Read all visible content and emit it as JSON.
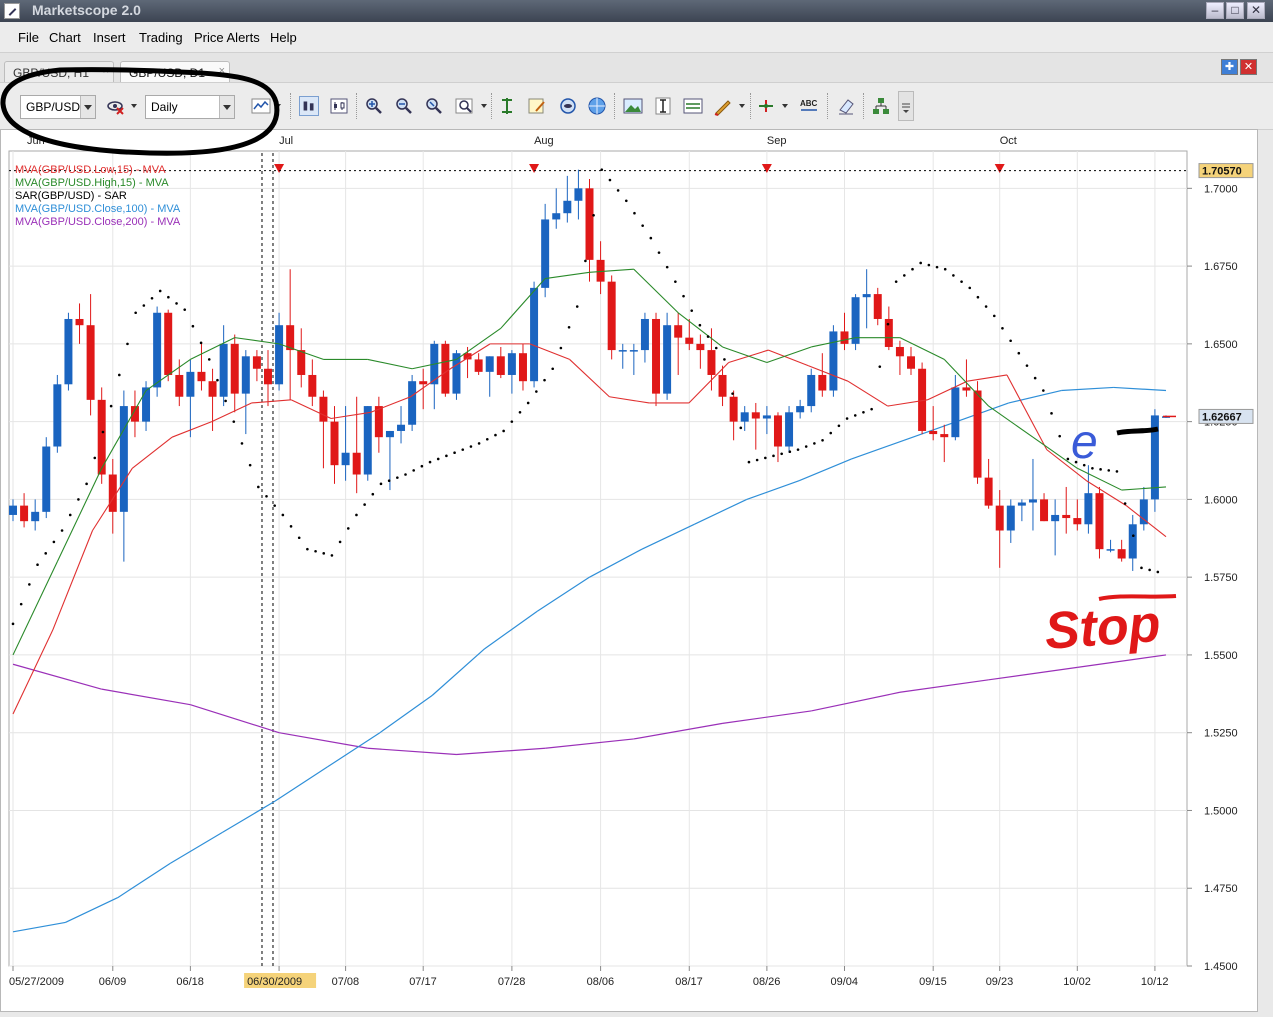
{
  "window": {
    "title": "Marketscope 2.0"
  },
  "menu": [
    "File",
    "Chart",
    "Insert",
    "Trading",
    "Price Alerts",
    "Help"
  ],
  "tabs": [
    {
      "label": "GBP/USD, H1",
      "active": false
    },
    {
      "label": "GBP/USD, D1",
      "active": true
    }
  ],
  "toolbar": {
    "instrument": "GBP/USD",
    "period": "Daily",
    "icons": [
      "cancel-eye-icon",
      "line-chart-icon",
      "bar-style-icon",
      "candle-style-icon",
      "zoom-in-icon",
      "zoom-out-icon",
      "zoom-fit-icon",
      "zoom-range-icon",
      "vertical-bar-icon",
      "note-icon",
      "globe-eye-icon",
      "globe-icon",
      "image-icon",
      "cursor-line-icon",
      "panel-icon",
      "pencil-icon",
      "trend-icon",
      "text-abc-icon",
      "eraser-icon",
      "tree-icon",
      "more-icon"
    ]
  },
  "chart_data": {
    "type": "candlestick",
    "instrument": "GBP/USD",
    "timeframe": "D1",
    "month_labels": [
      "Jun",
      "Jul",
      "Aug",
      "Sep",
      "Oct"
    ],
    "x_tick_labels": [
      "05/27/2009",
      "06/09",
      "06/18",
      "06/30/2009",
      "07/08",
      "07/17",
      "07/28",
      "08/06",
      "08/17",
      "08/26",
      "09/04",
      "09/15",
      "09/23",
      "10/02",
      "10/12"
    ],
    "highlighted_x_label": "06/30/2009",
    "y_tick_labels": [
      "1.7000",
      "1.6750",
      "1.6500",
      "1.6250",
      "1.6000",
      "1.5750",
      "1.5500",
      "1.5250",
      "1.5000",
      "1.4750",
      "1.4500"
    ],
    "ylim": [
      1.45,
      1.712
    ],
    "price_markers": [
      {
        "label": "1.70570",
        "value": 1.7057,
        "color": "#f5d37a"
      },
      {
        "label": "1.62667",
        "value": 1.62667,
        "color": "#d8e3f0"
      }
    ],
    "legend": [
      {
        "label": "MVA(GBP/USD.Low,15) - MVA",
        "color": "#e03030"
      },
      {
        "label": "MVA(GBP/USD.High,15) - MVA",
        "color": "#2a8a2a"
      },
      {
        "label": "SAR(GBP/USD) - SAR",
        "color": "#000000"
      },
      {
        "label": "MVA(GBP/USD.Close,100) - MVA",
        "color": "#2f8fd8"
      },
      {
        "label": "MVA(GBP/USD.Close,200) - MVA",
        "color": "#9a30b8"
      }
    ],
    "up_color": "#1a64c0",
    "down_color": "#e01818",
    "candles": [
      [
        1.595,
        1.6,
        1.593,
        1.598
      ],
      [
        1.598,
        1.602,
        1.591,
        1.593
      ],
      [
        1.593,
        1.6,
        1.59,
        1.596
      ],
      [
        1.596,
        1.62,
        1.594,
        1.617
      ],
      [
        1.617,
        1.64,
        1.615,
        1.637
      ],
      [
        1.637,
        1.66,
        1.635,
        1.658
      ],
      [
        1.658,
        1.663,
        1.65,
        1.656
      ],
      [
        1.656,
        1.666,
        1.627,
        1.632
      ],
      [
        1.632,
        1.636,
        1.605,
        1.608
      ],
      [
        1.608,
        1.613,
        1.589,
        1.596
      ],
      [
        1.596,
        1.635,
        1.58,
        1.63
      ],
      [
        1.63,
        1.635,
        1.62,
        1.625
      ],
      [
        1.625,
        1.638,
        1.622,
        1.636
      ],
      [
        1.636,
        1.662,
        1.633,
        1.66
      ],
      [
        1.66,
        1.661,
        1.638,
        1.64
      ],
      [
        1.64,
        1.645,
        1.63,
        1.633
      ],
      [
        1.633,
        1.645,
        1.62,
        1.641
      ],
      [
        1.641,
        1.65,
        1.635,
        1.638
      ],
      [
        1.638,
        1.642,
        1.622,
        1.633
      ],
      [
        1.633,
        1.656,
        1.63,
        1.65
      ],
      [
        1.65,
        1.653,
        1.628,
        1.634
      ],
      [
        1.634,
        1.648,
        1.621,
        1.646
      ],
      [
        1.646,
        1.648,
        1.638,
        1.642
      ],
      [
        1.642,
        1.648,
        1.63,
        1.637
      ],
      [
        1.637,
        1.66,
        1.635,
        1.656
      ],
      [
        1.656,
        1.674,
        1.632,
        1.648
      ],
      [
        1.648,
        1.655,
        1.636,
        1.64
      ],
      [
        1.64,
        1.645,
        1.63,
        1.633
      ],
      [
        1.633,
        1.635,
        1.61,
        1.625
      ],
      [
        1.625,
        1.63,
        1.605,
        1.611
      ],
      [
        1.611,
        1.63,
        1.606,
        1.615
      ],
      [
        1.615,
        1.633,
        1.602,
        1.608
      ],
      [
        1.608,
        1.63,
        1.606,
        1.63
      ],
      [
        1.63,
        1.633,
        1.615,
        1.62
      ],
      [
        1.62,
        1.622,
        1.603,
        1.622
      ],
      [
        1.622,
        1.63,
        1.618,
        1.624
      ],
      [
        1.624,
        1.64,
        1.622,
        1.638
      ],
      [
        1.638,
        1.642,
        1.629,
        1.637
      ],
      [
        1.637,
        1.651,
        1.629,
        1.65
      ],
      [
        1.65,
        1.651,
        1.633,
        1.634
      ],
      [
        1.634,
        1.648,
        1.632,
        1.647
      ],
      [
        1.647,
        1.649,
        1.639,
        1.645
      ],
      [
        1.645,
        1.647,
        1.64,
        1.641
      ],
      [
        1.641,
        1.646,
        1.633,
        1.646
      ],
      [
        1.646,
        1.649,
        1.639,
        1.64
      ],
      [
        1.64,
        1.648,
        1.634,
        1.647
      ],
      [
        1.647,
        1.65,
        1.635,
        1.638
      ],
      [
        1.638,
        1.67,
        1.636,
        1.668
      ],
      [
        1.668,
        1.695,
        1.665,
        1.69
      ],
      [
        1.69,
        1.7,
        1.687,
        1.692
      ],
      [
        1.692,
        1.704,
        1.689,
        1.696
      ],
      [
        1.696,
        1.706,
        1.69,
        1.7
      ],
      [
        1.7,
        1.703,
        1.67,
        1.677
      ],
      [
        1.677,
        1.683,
        1.666,
        1.67
      ],
      [
        1.67,
        1.672,
        1.645,
        1.648
      ],
      [
        1.648,
        1.65,
        1.642,
        1.648
      ],
      [
        1.648,
        1.65,
        1.64,
        1.648
      ],
      [
        1.648,
        1.66,
        1.644,
        1.658
      ],
      [
        1.658,
        1.66,
        1.63,
        1.634
      ],
      [
        1.634,
        1.66,
        1.632,
        1.656
      ],
      [
        1.656,
        1.66,
        1.64,
        1.652
      ],
      [
        1.652,
        1.658,
        1.648,
        1.65
      ],
      [
        1.65,
        1.653,
        1.642,
        1.648
      ],
      [
        1.648,
        1.655,
        1.635,
        1.64
      ],
      [
        1.64,
        1.643,
        1.63,
        1.633
      ],
      [
        1.633,
        1.635,
        1.619,
        1.625
      ],
      [
        1.625,
        1.63,
        1.622,
        1.628
      ],
      [
        1.628,
        1.631,
        1.616,
        1.626
      ],
      [
        1.626,
        1.63,
        1.621,
        1.627
      ],
      [
        1.627,
        1.628,
        1.612,
        1.617
      ],
      [
        1.617,
        1.63,
        1.615,
        1.628
      ],
      [
        1.628,
        1.632,
        1.626,
        1.63
      ],
      [
        1.63,
        1.642,
        1.628,
        1.64
      ],
      [
        1.64,
        1.647,
        1.633,
        1.635
      ],
      [
        1.635,
        1.656,
        1.633,
        1.654
      ],
      [
        1.654,
        1.66,
        1.648,
        1.65
      ],
      [
        1.65,
        1.666,
        1.648,
        1.665
      ],
      [
        1.665,
        1.674,
        1.655,
        1.666
      ],
      [
        1.666,
        1.668,
        1.656,
        1.658
      ],
      [
        1.658,
        1.662,
        1.648,
        1.649
      ],
      [
        1.649,
        1.651,
        1.64,
        1.646
      ],
      [
        1.646,
        1.649,
        1.64,
        1.642
      ],
      [
        1.642,
        1.644,
        1.621,
        1.622
      ],
      [
        1.622,
        1.63,
        1.619,
        1.621
      ],
      [
        1.621,
        1.624,
        1.612,
        1.62
      ],
      [
        1.62,
        1.64,
        1.619,
        1.636
      ],
      [
        1.636,
        1.645,
        1.633,
        1.635
      ],
      [
        1.635,
        1.638,
        1.605,
        1.607
      ],
      [
        1.607,
        1.613,
        1.597,
        1.598
      ],
      [
        1.598,
        1.603,
        1.578,
        1.59
      ],
      [
        1.59,
        1.6,
        1.586,
        1.598
      ],
      [
        1.598,
        1.6,
        1.593,
        1.599
      ],
      [
        1.599,
        1.613,
        1.59,
        1.6
      ],
      [
        1.6,
        1.602,
        1.593,
        1.593
      ],
      [
        1.593,
        1.6,
        1.582,
        1.595
      ],
      [
        1.595,
        1.604,
        1.589,
        1.594
      ],
      [
        1.594,
        1.6,
        1.59,
        1.592
      ],
      [
        1.592,
        1.611,
        1.589,
        1.602
      ],
      [
        1.602,
        1.604,
        1.581,
        1.584
      ],
      [
        1.584,
        1.587,
        1.583,
        1.584
      ],
      [
        1.584,
        1.587,
        1.58,
        1.581
      ],
      [
        1.581,
        1.595,
        1.577,
        1.592
      ],
      [
        1.592,
        1.604,
        1.59,
        1.6
      ],
      [
        1.6,
        1.629,
        1.596,
        1.627
      ],
      [
        1.6267,
        1.627,
        1.6262,
        1.6267
      ]
    ],
    "sma_low_15": [
      [
        1.531,
        1.558
      ],
      [
        1.558,
        1.59
      ],
      [
        1.59,
        1.61
      ],
      [
        1.61,
        1.62
      ],
      [
        1.62,
        1.625
      ],
      [
        1.625,
        1.631
      ],
      [
        1.631,
        1.632
      ],
      [
        1.632,
        1.626
      ],
      [
        1.626,
        1.628
      ],
      [
        1.628,
        1.633
      ],
      [
        1.633,
        1.642
      ],
      [
        1.642,
        1.65
      ],
      [
        1.65,
        1.65
      ],
      [
        1.65,
        1.645
      ],
      [
        1.645,
        1.633
      ],
      [
        1.633,
        1.631
      ],
      [
        1.631,
        1.631
      ],
      [
        1.631,
        1.644
      ],
      [
        1.644,
        1.648
      ],
      [
        1.648,
        1.643
      ],
      [
        1.643,
        1.638
      ],
      [
        1.638,
        1.63
      ],
      [
        1.63,
        1.632
      ],
      [
        1.632,
        1.638
      ],
      [
        1.638,
        1.64
      ],
      [
        1.64,
        1.616
      ],
      [
        1.616,
        1.606
      ],
      [
        1.606,
        1.598
      ],
      [
        1.598,
        1.588
      ]
    ],
    "sma_high_15": [
      [
        1.55,
        1.58
      ],
      [
        1.58,
        1.61
      ],
      [
        1.61,
        1.635
      ],
      [
        1.635,
        1.645
      ],
      [
        1.645,
        1.652
      ],
      [
        1.652,
        1.65
      ],
      [
        1.65,
        1.645
      ],
      [
        1.645,
        1.645
      ],
      [
        1.645,
        1.642
      ],
      [
        1.642,
        1.645
      ],
      [
        1.645,
        1.655
      ],
      [
        1.655,
        1.671
      ],
      [
        1.671,
        1.673
      ],
      [
        1.673,
        1.674
      ],
      [
        1.674,
        1.66
      ],
      [
        1.66,
        1.649
      ],
      [
        1.649,
        1.644
      ],
      [
        1.644,
        1.649
      ],
      [
        1.649,
        1.652
      ],
      [
        1.652,
        1.652
      ],
      [
        1.652,
        1.645
      ],
      [
        1.645,
        1.63
      ],
      [
        1.63,
        1.62
      ],
      [
        1.62,
        1.61
      ],
      [
        1.61,
        1.603
      ],
      [
        1.603,
        1.604
      ]
    ],
    "sma_close_100": [
      [
        1.461,
        1.464
      ],
      [
        1.464,
        1.472
      ],
      [
        1.472,
        1.483
      ],
      [
        1.483,
        1.493
      ],
      [
        1.493,
        1.503
      ],
      [
        1.503,
        1.514
      ],
      [
        1.514,
        1.525
      ],
      [
        1.525,
        1.537
      ],
      [
        1.537,
        1.552
      ],
      [
        1.552,
        1.564
      ],
      [
        1.564,
        1.575
      ],
      [
        1.575,
        1.584
      ],
      [
        1.584,
        1.592
      ],
      [
        1.592,
        1.6
      ],
      [
        1.6,
        1.606
      ],
      [
        1.606,
        1.613
      ],
      [
        1.613,
        1.619
      ],
      [
        1.619,
        1.625
      ],
      [
        1.625,
        1.631
      ],
      [
        1.631,
        1.635
      ],
      [
        1.635,
        1.636
      ],
      [
        1.636,
        1.635
      ]
    ],
    "sma_close_200": [
      [
        1.547,
        1.539
      ],
      [
        1.539,
        1.534
      ],
      [
        1.534,
        1.525
      ],
      [
        1.525,
        1.52
      ],
      [
        1.52,
        1.518
      ],
      [
        1.518,
        1.52
      ],
      [
        1.52,
        1.523
      ],
      [
        1.523,
        1.528
      ],
      [
        1.528,
        1.532
      ],
      [
        1.532,
        1.538
      ],
      [
        1.538,
        1.542
      ],
      [
        1.542,
        1.546
      ],
      [
        1.546,
        1.55
      ]
    ],
    "parabolic_sar": [
      [
        1.56,
        1.579
      ],
      [
        1.579,
        1.59
      ],
      [
        1.59,
        1.605
      ],
      [
        1.605,
        1.63
      ],
      [
        1.63,
        1.66
      ],
      [
        1.66,
        1.667
      ],
      [
        1.667,
        1.661
      ],
      [
        1.661,
        1.645
      ],
      [
        1.645,
        1.625
      ],
      [
        1.625,
        1.604
      ],
      [
        1.604,
        1.595
      ],
      [
        1.595,
        1.584
      ],
      [
        1.584,
        1.582
      ],
      [
        1.582,
        1.595
      ],
      [
        1.595,
        1.605
      ],
      [
        1.605,
        1.608
      ],
      [
        1.608,
        1.612
      ],
      [
        1.612,
        1.615
      ],
      [
        1.615,
        1.618
      ],
      [
        1.618,
        1.622
      ],
      [
        1.622,
        1.631
      ],
      [
        1.631,
        1.642
      ],
      [
        1.642,
        1.662
      ],
      [
        1.662,
        1.706
      ],
      [
        1.706,
        1.696
      ],
      [
        1.696,
        1.684
      ],
      [
        1.684,
        1.67
      ],
      [
        1.67,
        1.656
      ],
      [
        1.656,
        1.645
      ],
      [
        1.645,
        1.612
      ],
      [
        1.612,
        1.614
      ],
      [
        1.614,
        1.616
      ],
      [
        1.616,
        1.619
      ],
      [
        1.619,
        1.626
      ],
      [
        1.626,
        1.629
      ],
      [
        1.629,
        1.67
      ],
      [
        1.67,
        1.676
      ],
      [
        1.676,
        1.674
      ],
      [
        1.674,
        1.668
      ],
      [
        1.668,
        1.659
      ],
      [
        1.659,
        1.647
      ],
      [
        1.647,
        1.635
      ],
      [
        1.635,
        1.613
      ],
      [
        1.613,
        1.61
      ],
      [
        1.61,
        1.609
      ],
      [
        1.609,
        1.578
      ],
      [
        1.578,
        1.576
      ]
    ],
    "annotations": [
      {
        "text": "e",
        "color": "#3a5bd8"
      },
      {
        "text": "Stop",
        "color": "#e01818"
      }
    ]
  }
}
